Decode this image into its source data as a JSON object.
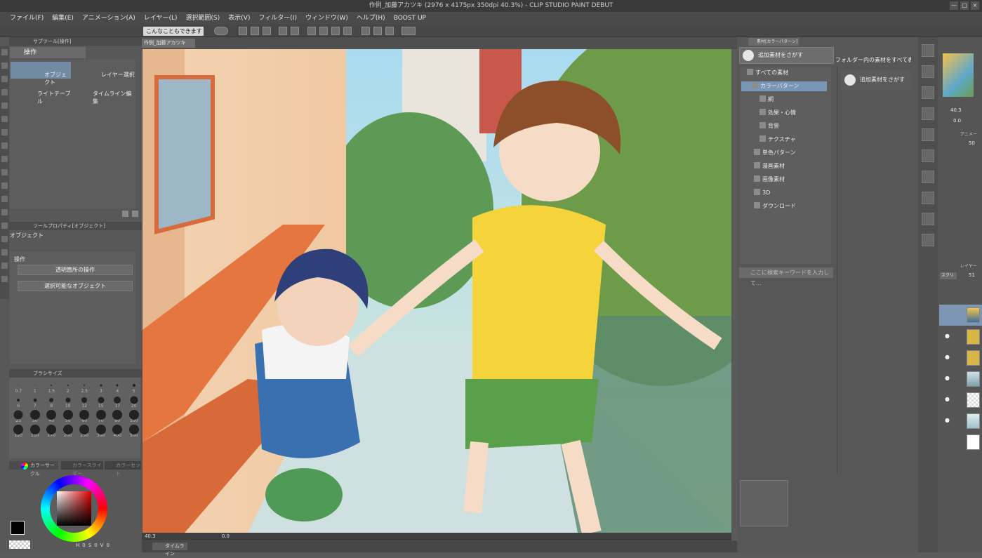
{
  "window": {
    "title": "作例_加藤アカツキ (2976 x 4175px 350dpi 40.3%) - CLIP STUDIO PAINT DEBUT",
    "min": "—",
    "max": "□",
    "close": "×"
  },
  "menu": [
    "ファイル(F)",
    "編集(E)",
    "アニメーション(A)",
    "レイヤー(L)",
    "選択範囲(S)",
    "表示(V)",
    "フィルター(I)",
    "ウィンドウ(W)",
    "ヘルプ(H)",
    "BOOST UP"
  ],
  "command": {
    "search_label": "こんなこともできます"
  },
  "sub_tool": {
    "header": "サブツール[操作]",
    "active": "操作",
    "items": [
      "オブジェクト",
      "レイヤー選択",
      "ライトテーブル",
      "タイムライン編集"
    ]
  },
  "tool_property": {
    "header": "ツールプロパティ[オブジェクト]",
    "title": "オブジェクト",
    "section": "操作",
    "dropdown1": "透明箇所の操作",
    "dropdown2": "選択可能なオブジェクト"
  },
  "brush_size": {
    "header": "ブラシサイズ",
    "sizes": [
      "0.7",
      "1",
      "1.5",
      "2",
      "2.5",
      "3",
      "4",
      "5",
      "6",
      "7",
      "8",
      "10",
      "12",
      "15",
      "17",
      "20",
      "25",
      "30",
      "40",
      "50",
      "60",
      "70",
      "80",
      "100",
      "120",
      "150",
      "170",
      "200",
      "250",
      "300",
      "400",
      "500"
    ]
  },
  "color": {
    "tab1": "カラーサークル",
    "tab2": "カラースライダー",
    "tab3": "カラーセット",
    "main": "#000000",
    "sub": "#ffffff",
    "hsv": [
      "H",
      "0",
      "S",
      "0",
      "V",
      "0"
    ]
  },
  "document": {
    "tab": "作例_加藤アカツキ",
    "zoom": "40.3",
    "angle": "0.0"
  },
  "timeline": {
    "tab": "タイムライン"
  },
  "material": {
    "tab": "素材[カラーパターン]",
    "find_button": "追加素材をさがす",
    "folder_all": "フォルダー内の素材をすべて表示",
    "find_button2": "追加素材をさがす",
    "tree": [
      "すべての素材",
      "カラーパターン",
      "網",
      "効果・心情",
      "背景",
      "テクスチャ",
      "単色パターン",
      "漫画素材",
      "画像素材",
      "3D",
      "ダウンロード"
    ],
    "search_placeholder": "ここに検索キーワードを入力して..."
  },
  "navigator": {
    "zoom": "40.3",
    "angle": "0.0",
    "anim_tab": "アニメー",
    "value": "50"
  },
  "layers": {
    "tab": "レイヤー",
    "blend": "スクリ",
    "opacity": "51"
  }
}
